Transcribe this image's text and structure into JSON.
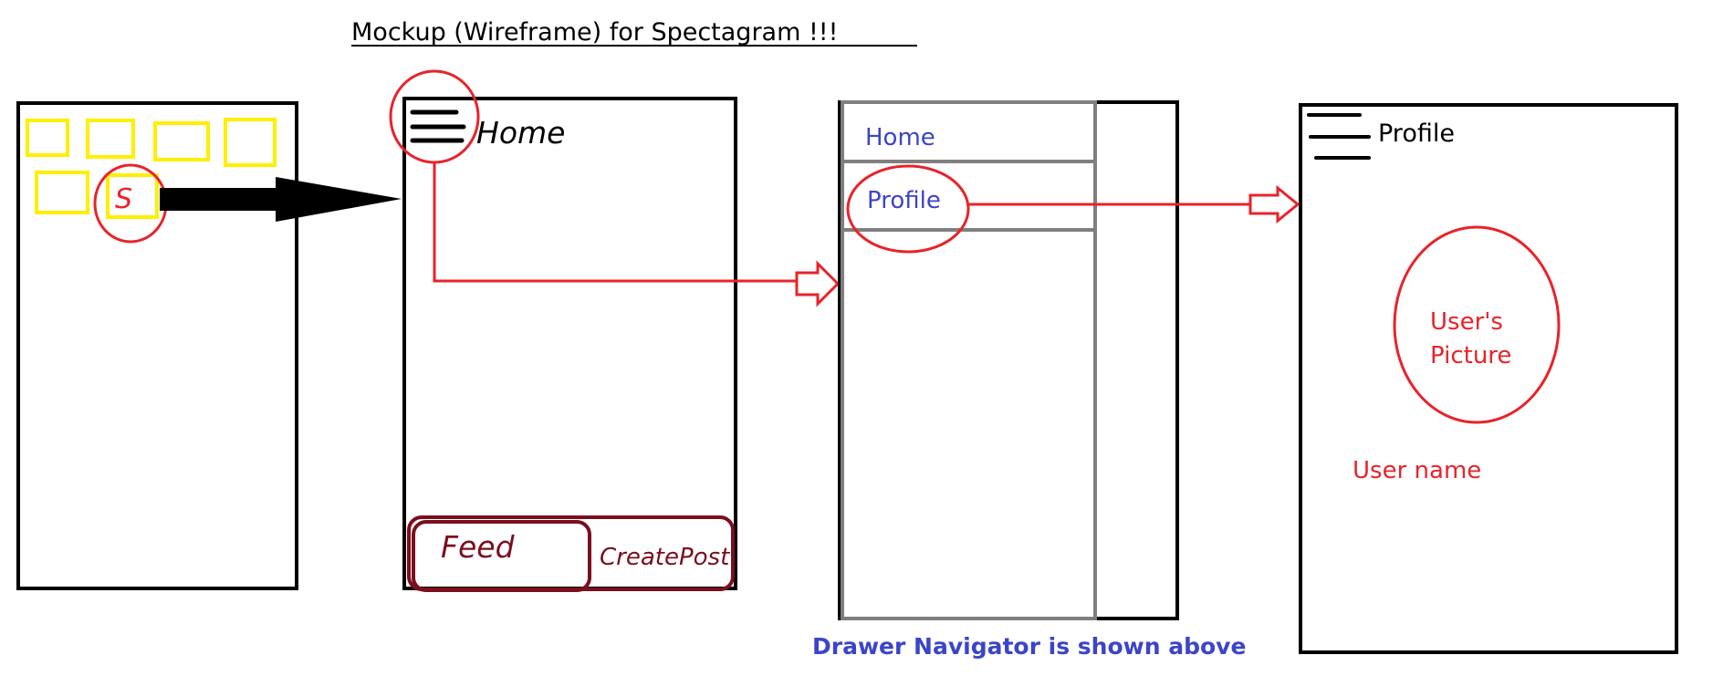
{
  "title": "Mockup (Wireframe) for Spectagram !!!",
  "launcher": {
    "app_icon_label": "S"
  },
  "home_screen": {
    "title": "Home",
    "tab_feed": "Feed",
    "tab_create_post": "CreatePost"
  },
  "drawer_screen": {
    "items": [
      "Home",
      "Profile"
    ],
    "caption": "Drawer Navigator is shown above"
  },
  "profile_screen": {
    "title": "Profile",
    "picture_label_line1": "User's",
    "picture_label_line2": "Picture",
    "user_name_label": "User name"
  },
  "colors": {
    "outline": "#000000",
    "highlight_red": "#e8232a",
    "app_icon_yellow": "#ffef00",
    "tab_maroon": "#7a0f1e",
    "drawer_blue": "#3c44c8",
    "drawer_border_gray": "#7f7f7f"
  }
}
